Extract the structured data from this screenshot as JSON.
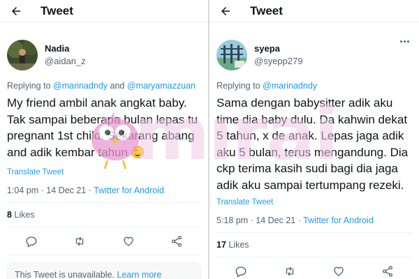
{
  "left": {
    "header": {
      "title": "Tweet"
    },
    "author": {
      "display_name": "Nadia",
      "handle": "@aidan_z"
    },
    "replying": {
      "prefix": "Replying to ",
      "mention1": "@marinadndy",
      "joiner": " and ",
      "mention2": "@maryamazzuan"
    },
    "tweet_text": "My friend ambil anak angkat baby. Tak sampai beberapa bulan lepas tu pregnant 1st child. Sekarang abang and adik kembar tahun",
    "translate": "Translate Tweet",
    "meta": {
      "time": "1:04 pm",
      "sep": " · ",
      "date": "14 Dec 21",
      "sep2": " · ",
      "client": "Twitter for Android"
    },
    "stats": {
      "likes_count": "8",
      "likes_label": " Likes"
    },
    "unavailable": {
      "text": "This Tweet is unavailable. ",
      "link": "Learn more"
    }
  },
  "right": {
    "header": {
      "title": "Tweet"
    },
    "author": {
      "display_name": "syepa",
      "handle": "@syepp279"
    },
    "replying": {
      "prefix": "Replying to ",
      "mention1": "@marinadndy"
    },
    "tweet_text": "Sama dengan babysitter adik aku time dia baby dulu. Da kahwin dekat 5 tahun, x de anak. Lepas jaga adik aku 5 bulan, terus mengandung. Dia ckp terima kasih sudi bagi dia jaga adik aku sampai tertumpang rezeki.",
    "translate": "Translate Tweet",
    "meta": {
      "time": "5:18 pm",
      "sep": " · ",
      "date": "14 Dec 21",
      "sep2": " · ",
      "client": "Twitter for Android"
    },
    "stats": {
      "likes_count": "17",
      "likes_label": " Likes"
    }
  },
  "watermark": {
    "text": "mırai"
  },
  "colors": {
    "accent": "#1d9bf0",
    "muted": "#536471",
    "text": "#0f1419",
    "watermark": "#eec8e4"
  },
  "icons": [
    "back-arrow-icon",
    "more-icon",
    "reply-icon",
    "retweet-icon",
    "like-icon",
    "share-icon",
    "smiling-face-emoji"
  ]
}
